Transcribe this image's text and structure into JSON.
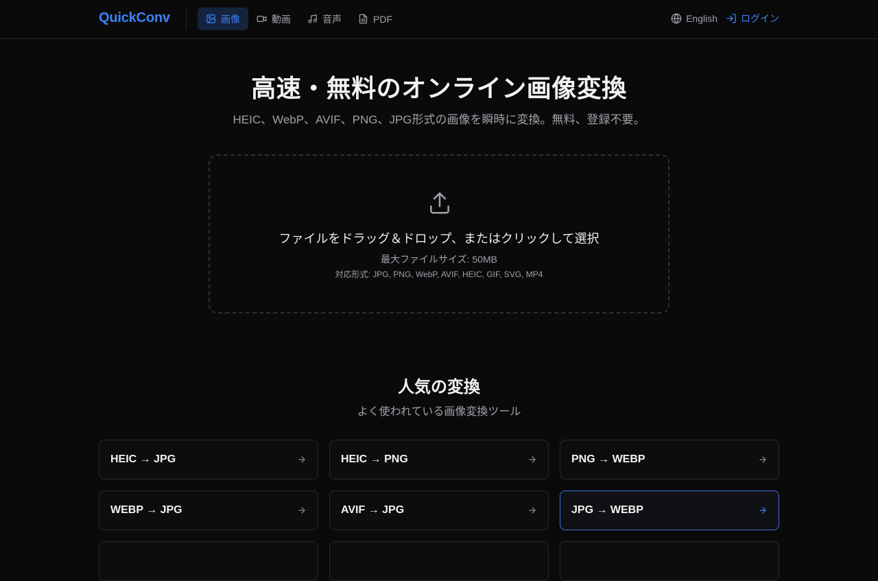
{
  "header": {
    "brand": "QuickConv",
    "nav": [
      {
        "label": "画像",
        "icon": "image-icon"
      },
      {
        "label": "動画",
        "icon": "video-icon"
      },
      {
        "label": "音声",
        "icon": "music-icon"
      },
      {
        "label": "PDF",
        "icon": "file-icon"
      }
    ],
    "language": "English",
    "login": "ログイン"
  },
  "hero": {
    "title": "高速・無料のオンライン画像変換",
    "subtitle": "HEIC、WebP、AVIF、PNG、JPG形式の画像を瞬時に変換。無料、登録不要。"
  },
  "dropzone": {
    "main": "ファイルをドラッグ＆ドロップ、またはクリックして選択",
    "max_size": "最大ファイルサイズ: 50MB",
    "formats": "対応形式: JPG, PNG, WebP, AVIF, HEIC, GIF, SVG, MP4"
  },
  "popular": {
    "title": "人気の変換",
    "subtitle": "よく使われている画像変換ツール",
    "items": [
      {
        "label": "HEIC → JPG"
      },
      {
        "label": "HEIC → PNG"
      },
      {
        "label": "PNG → WEBP"
      },
      {
        "label": "WEBP → JPG"
      },
      {
        "label": "AVIF → JPG"
      },
      {
        "label": "JPG → WEBP"
      }
    ]
  },
  "colors": {
    "accent": "#3b82f6",
    "background": "#0a0a0b"
  }
}
